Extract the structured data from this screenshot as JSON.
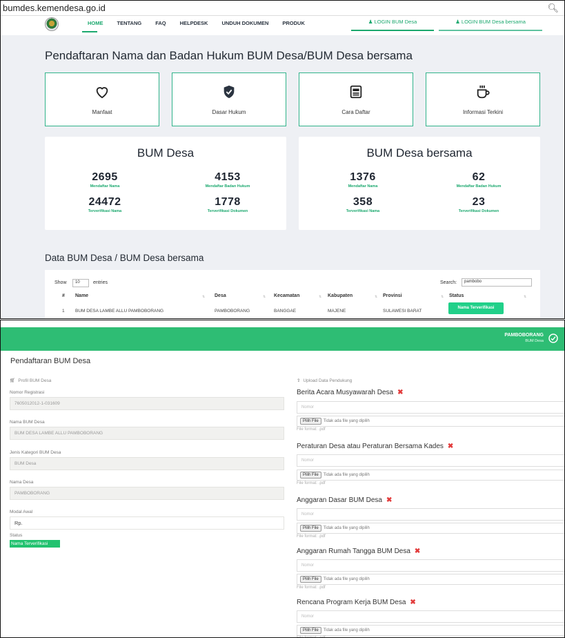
{
  "browser": {
    "url": "bumdes.kemendesa.go.id",
    "search_icon": "magnifier-icon"
  },
  "nav": {
    "items": [
      {
        "label": "HOME"
      },
      {
        "label": "TENTANG"
      },
      {
        "label": "FAQ"
      },
      {
        "label": "HELPDESK"
      },
      {
        "label": "UNDUH DOKUMEN"
      },
      {
        "label": "PRODUK"
      }
    ],
    "login_bum_desa": "LOGIN BUM Desa",
    "login_bum_desa_bersama": "LOGIN BUM Desa bersama"
  },
  "page_title": "Pendaftaran Nama dan Badan Hukum BUM Desa/BUM Desa bersama",
  "cards": [
    {
      "label": "Manfaat",
      "icon": "heart-icon"
    },
    {
      "label": "Dasar Hukum",
      "icon": "shield-check-icon"
    },
    {
      "label": "Cara Daftar",
      "icon": "document-list-icon"
    },
    {
      "label": "Informasi Terkini",
      "icon": "coffee-cup-icon"
    }
  ],
  "stats_desa": {
    "title": "BUM Desa",
    "items": [
      {
        "value": "2695",
        "label": "Mendaftar Nama"
      },
      {
        "value": "4153",
        "label": "Mendaftar Badan Hukum"
      },
      {
        "value": "24472",
        "label": "Terverifikasi Nama"
      },
      {
        "value": "1778",
        "label": "Terverifikasi Dokumen"
      }
    ]
  },
  "stats_bersama": {
    "title": "BUM Desa bersama",
    "items": [
      {
        "value": "1376",
        "label": "Mendaftar Nama"
      },
      {
        "value": "62",
        "label": "Mendaftar Badan Hukum"
      },
      {
        "value": "358",
        "label": "Terverifikasi Nama"
      },
      {
        "value": "23",
        "label": "Terverifikasi Dokumen"
      }
    ]
  },
  "table": {
    "title": "Data BUM Desa / BUM Desa bersama",
    "show_label": "Show",
    "show_value": "10",
    "entries_label": "entries",
    "search_label": "Search:",
    "search_value": "pambobo",
    "headers": [
      "#",
      "Name",
      "Desa",
      "Kecamatan",
      "Kabupaten",
      "Provinsi",
      "Status"
    ],
    "row": {
      "no": "1",
      "name": "BUM DESA LAMBE ALLU PAMBOBORANG",
      "desa": "PAMBOBORANG",
      "kecamatan": "BANGGAE",
      "kabupaten": "MAJENE",
      "provinsi": "SULAWESI BARAT",
      "status": "Nama Terverifikasi"
    }
  },
  "form": {
    "header_name": "PAMBOBORANG",
    "header_sub": "BUM Desa",
    "title": "Pendaftaran BUM Desa",
    "profil_header": "Profil BUM Desa",
    "fields": [
      {
        "label": "Nomor Registrasi",
        "value": "7605012012-1-031609"
      },
      {
        "label": "Nama BUM Desa",
        "value": "BUM DESA LAMBE ALLU PAMBOBORANG"
      },
      {
        "label": "Jenis Kategori BUM Desa",
        "value": "BUM Desa"
      },
      {
        "label": "Nama Desa",
        "value": "PAMBOBORANG"
      }
    ],
    "modal_label": "Modal Awal",
    "modal_value": "Rp.",
    "status_label": "Status",
    "status_value": "Nama Terverifikasi",
    "upload_header": "Upload Data Pendukung",
    "uploads": [
      {
        "title": "Berita Acara Musyawarah Desa"
      },
      {
        "title": "Peraturan Desa atau Peraturan Bersama Kades"
      },
      {
        "title": "Anggaran Dasar BUM Desa"
      },
      {
        "title": "Anggaran Rumah Tangga BUM Desa"
      },
      {
        "title": "Rencana Program Kerja BUM Desa"
      }
    ],
    "required_mark": "✖",
    "nomor_placeholder": "Nomor",
    "pilih_file": "Pilih File",
    "no_file": "Tidak ada file yang dipilih",
    "file_format": "File format: .pdf"
  }
}
